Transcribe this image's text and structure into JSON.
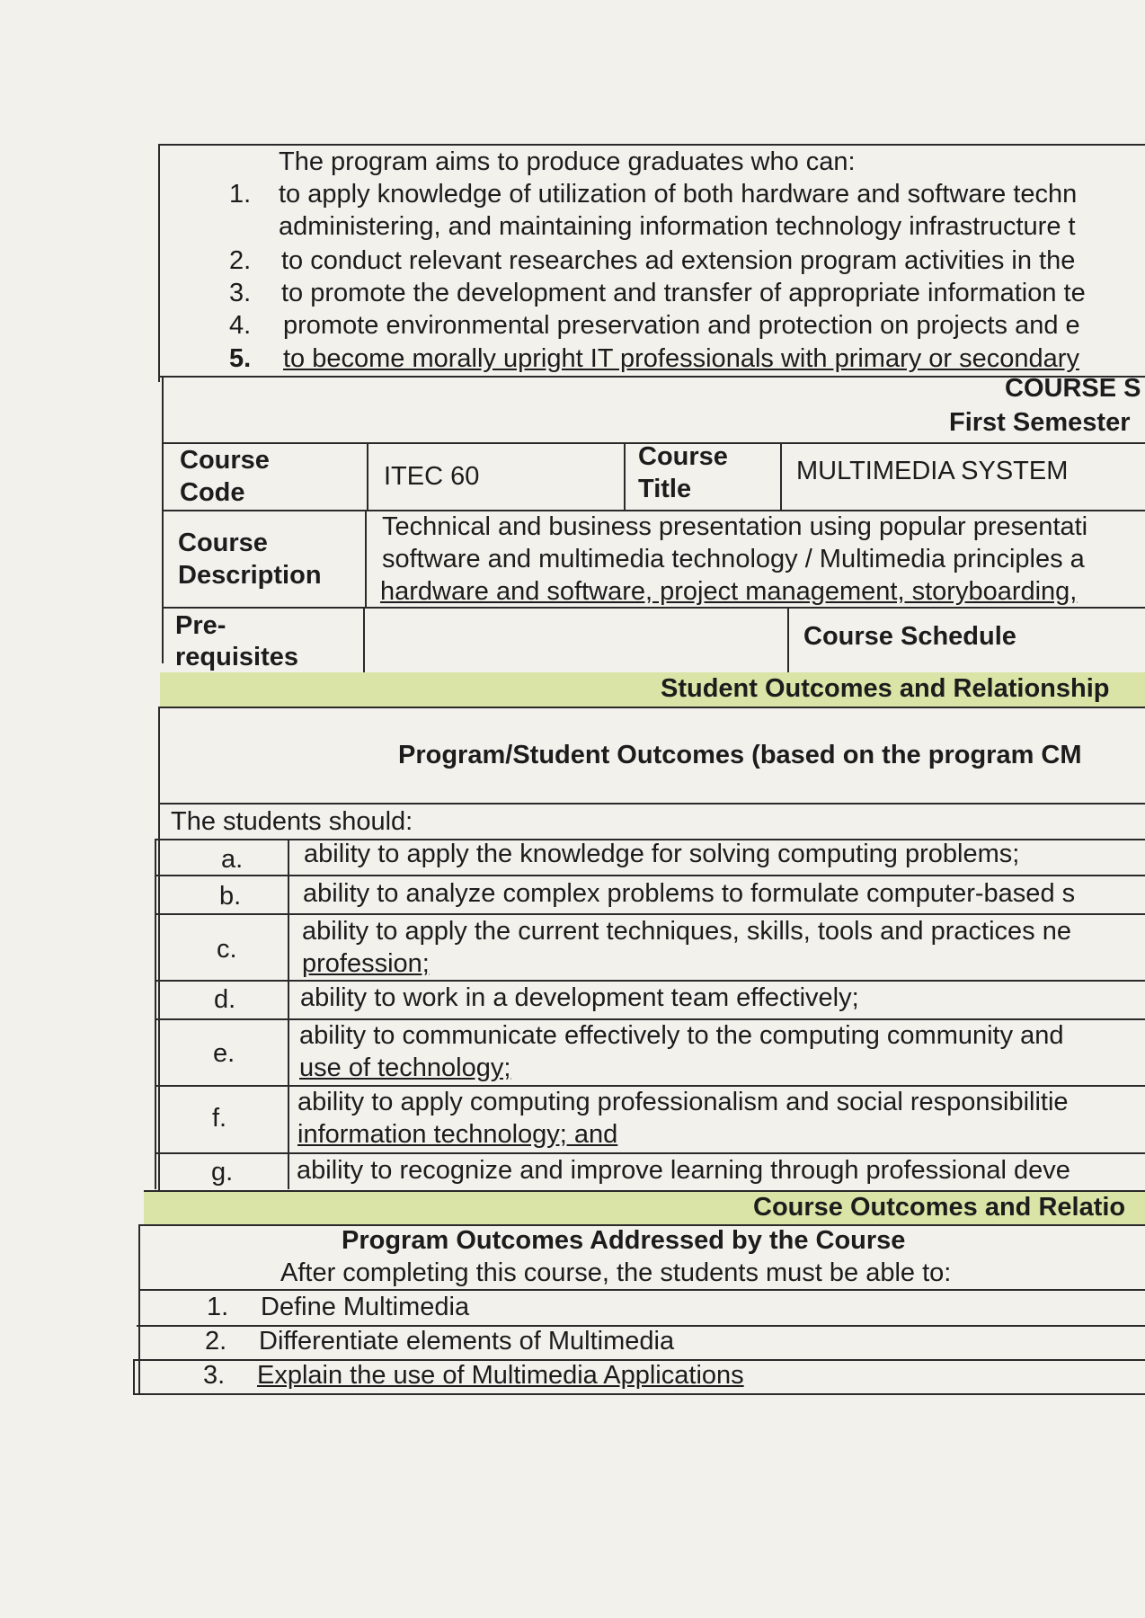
{
  "program_objectives": {
    "intro": "The program aims to produce graduates who can:",
    "items": [
      {
        "num": "1.",
        "lines": [
          "to apply knowledge of utilization of both hardware and software techn",
          "administering, and maintaining information technology infrastructure t"
        ]
      },
      {
        "num": "2.",
        "lines": [
          "to conduct relevant researches ad extension program activities in the"
        ]
      },
      {
        "num": "3.",
        "lines": [
          "to promote the development and transfer of appropriate information te"
        ]
      },
      {
        "num": "4.",
        "lines": [
          "promote environmental preservation and protection on projects and e"
        ]
      },
      {
        "num": "5.",
        "lines": [
          "to become morally upright IT professionals with primary or secondary"
        ]
      }
    ]
  },
  "course_header": {
    "title": "COURSE S",
    "semester": "First Semester"
  },
  "course_info": {
    "code_label": [
      "Course",
      "Code"
    ],
    "code_value": "ITEC 60",
    "title_label": [
      "Course",
      "Title"
    ],
    "title_value": "MULTIMEDIA SYSTEM",
    "description_label": [
      "Course",
      "Description"
    ],
    "description_lines": [
      "Technical and business presentation using popular presentati",
      "software and multimedia technology / Multimedia principles a",
      "hardware and software, project management, storyboarding,"
    ],
    "prereq_label": [
      "Pre-",
      "requisites"
    ],
    "prereq_value": "",
    "schedule_label": "Course Schedule"
  },
  "student_outcomes": {
    "band_title": "Student Outcomes and Relationship",
    "heading": "Program/Student Outcomes (based on the program CM",
    "intro": "The students should:",
    "items": [
      {
        "letter": "a.",
        "lines": [
          "ability to apply the knowledge for solving computing problems;"
        ]
      },
      {
        "letter": "b.",
        "lines": [
          "ability to analyze complex problems to formulate computer-based s"
        ]
      },
      {
        "letter": "c.",
        "lines": [
          "ability to apply the current techniques, skills, tools and practices ne",
          "profession;"
        ]
      },
      {
        "letter": "d.",
        "lines": [
          "ability to work in a development team effectively;"
        ]
      },
      {
        "letter": "e.",
        "lines": [
          "ability to communicate effectively to the computing community and",
          "use of technology;"
        ]
      },
      {
        "letter": "f.",
        "lines": [
          "ability to apply computing professionalism and social responsibilitie",
          "information technology; and"
        ]
      },
      {
        "letter": "g.",
        "lines": [
          "ability to recognize and improve learning through professional deve"
        ]
      }
    ]
  },
  "course_outcomes": {
    "band_title": "Course Outcomes and Relatio",
    "heading": "Program Outcomes Addressed by the Course",
    "subheading": "After completing this course, the students must be able to:",
    "items": [
      {
        "num": "1.",
        "text": "Define Multimedia"
      },
      {
        "num": "2.",
        "text": "Differentiate elements of Multimedia"
      },
      {
        "num": "3.",
        "text": "Explain the use of Multimedia Applications"
      }
    ]
  }
}
